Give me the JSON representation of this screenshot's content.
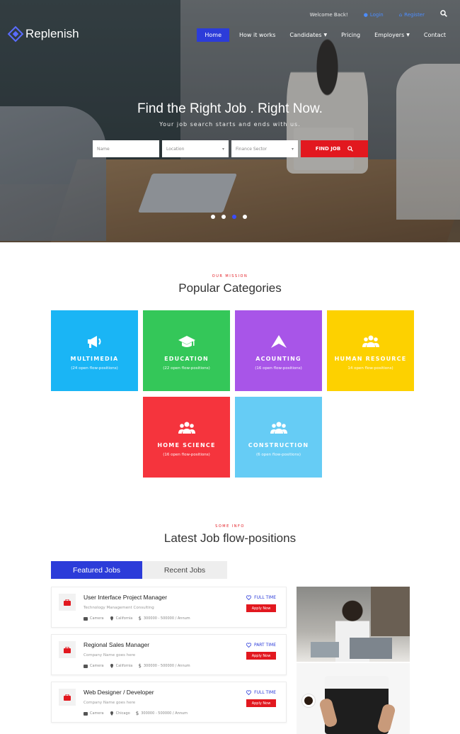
{
  "topbar": {
    "welcome": "Welcome Back!",
    "login": "Login",
    "register": "Register"
  },
  "brand": {
    "name": "Replenish"
  },
  "nav": [
    {
      "label": "Home",
      "active": true,
      "dropdown": false
    },
    {
      "label": "How it works",
      "active": false,
      "dropdown": false
    },
    {
      "label": "Candidates",
      "active": false,
      "dropdown": true
    },
    {
      "label": "Pricing",
      "active": false,
      "dropdown": false
    },
    {
      "label": "Employers",
      "active": false,
      "dropdown": true
    },
    {
      "label": "Contact",
      "active": false,
      "dropdown": false
    }
  ],
  "hero": {
    "title": "Find the Right Job . Right Now.",
    "subtitle": "Your job search starts and ends with us.",
    "search": {
      "name_placeholder": "Name",
      "location_value": "Location",
      "sector_value": "Finance Sector",
      "button_label": "FIND JOB"
    },
    "slider": {
      "count": 4,
      "active_index": 2
    }
  },
  "categories_section": {
    "eyebrow": "OUR MISSION",
    "title": "Popular Categories",
    "items": [
      {
        "name": "MULTIMEDIA",
        "count": "(24 open flow-positions)",
        "color": "#1ab5f5",
        "icon": "megaphone-icon"
      },
      {
        "name": "EDUCATION",
        "count": "(22 open flow-positions)",
        "color": "#34c759",
        "icon": "graduation-cap-icon"
      },
      {
        "name": "ACOUNTING",
        "count": "(16 open flow-positions)",
        "color": "#a855e8",
        "icon": "paper-plane-icon"
      },
      {
        "name": "HUMAN RESOURCE",
        "count": "14 open flow-positions)",
        "color": "#fdd100",
        "icon": "users-icon"
      },
      {
        "name": "HOME SCIENCE",
        "count": "(16 open flow-positions)",
        "color": "#f5343d",
        "icon": "users-icon"
      },
      {
        "name": "CONSTRUCTION",
        "count": "(6 open flow-positions)",
        "color": "#66ccf5",
        "icon": "users-icon"
      }
    ]
  },
  "jobs_section": {
    "eyebrow": "SOME INFO",
    "title": "Latest Job flow-positions",
    "tabs": [
      "Featured Jobs",
      "Recent Jobs"
    ],
    "apply_label": "Apply Now",
    "jobs": [
      {
        "title": "User Interface Project Manager",
        "company": "Technology Management Consulting",
        "camera": "Camera",
        "location": "California",
        "salary": "300000 - 500000 / Annum",
        "type": "FULL TIME"
      },
      {
        "title": "Regional Sales Manager",
        "company": "Company Name goes here",
        "camera": "Camera",
        "location": "California",
        "salary": "300000 - 500000 / Annum",
        "type": "PART TIME"
      },
      {
        "title": "Web Designer / Developer",
        "company": "Company Name goes here",
        "camera": "Camera",
        "location": "Chicago",
        "salary": "300000 - 500000 / Annum",
        "type": "FULL TIME"
      }
    ]
  },
  "colors": {
    "primary": "#2c3cd9",
    "accent": "#e2181f"
  }
}
